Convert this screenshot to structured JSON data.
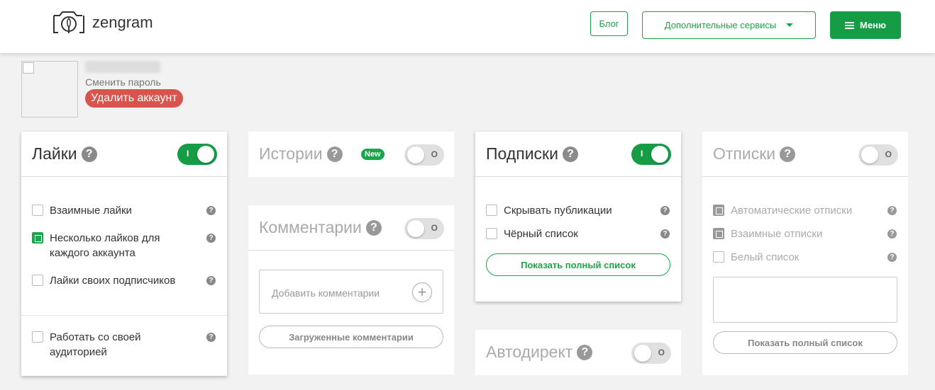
{
  "header": {
    "logo_text": "zengram",
    "blog_label": "Блог",
    "services_label": "Дополнительные сервисы",
    "menu_label": "Меню"
  },
  "profile": {
    "change_password": "Сменить пароль",
    "delete_account": "Удалить аккаунт"
  },
  "cards": {
    "likes": {
      "title": "Лайки",
      "toggle_mark": "I",
      "enabled": true,
      "options": [
        {
          "label": "Взаимные лайки",
          "checked": false
        },
        {
          "label": "Несколько лайков для каждого аккаунта",
          "checked": true
        },
        {
          "label": "Лайки своих подписчиков",
          "checked": false
        },
        {
          "label": "Работать со своей аудиторией",
          "checked": false
        }
      ]
    },
    "stories": {
      "title": "Истории",
      "badge": "New",
      "toggle_mark": "O",
      "enabled": false
    },
    "comments": {
      "title": "Комментарии",
      "toggle_mark": "O",
      "enabled": false,
      "add_label": "Добавить комментарии",
      "loaded_button": "Загруженные комментарии"
    },
    "follows": {
      "title": "Подписки",
      "toggle_mark": "I",
      "enabled": true,
      "options": [
        {
          "label": "Скрывать публикации",
          "checked": false
        },
        {
          "label": "Чёрный список",
          "checked": false
        }
      ],
      "show_list_button": "Показать полный список"
    },
    "autodirect": {
      "title": "Автодирект",
      "toggle_mark": "O",
      "enabled": false
    },
    "unfollows": {
      "title": "Отписки",
      "toggle_mark": "O",
      "enabled": false,
      "options": [
        {
          "label": "Автоматические отписки",
          "checked": true
        },
        {
          "label": "Взаимные отписки",
          "checked": true
        },
        {
          "label": "Белый список",
          "checked": false
        }
      ],
      "show_list_button": "Показать полный список"
    }
  },
  "colors": {
    "brand_green": "#169c44",
    "danger_red": "#d9534f"
  }
}
